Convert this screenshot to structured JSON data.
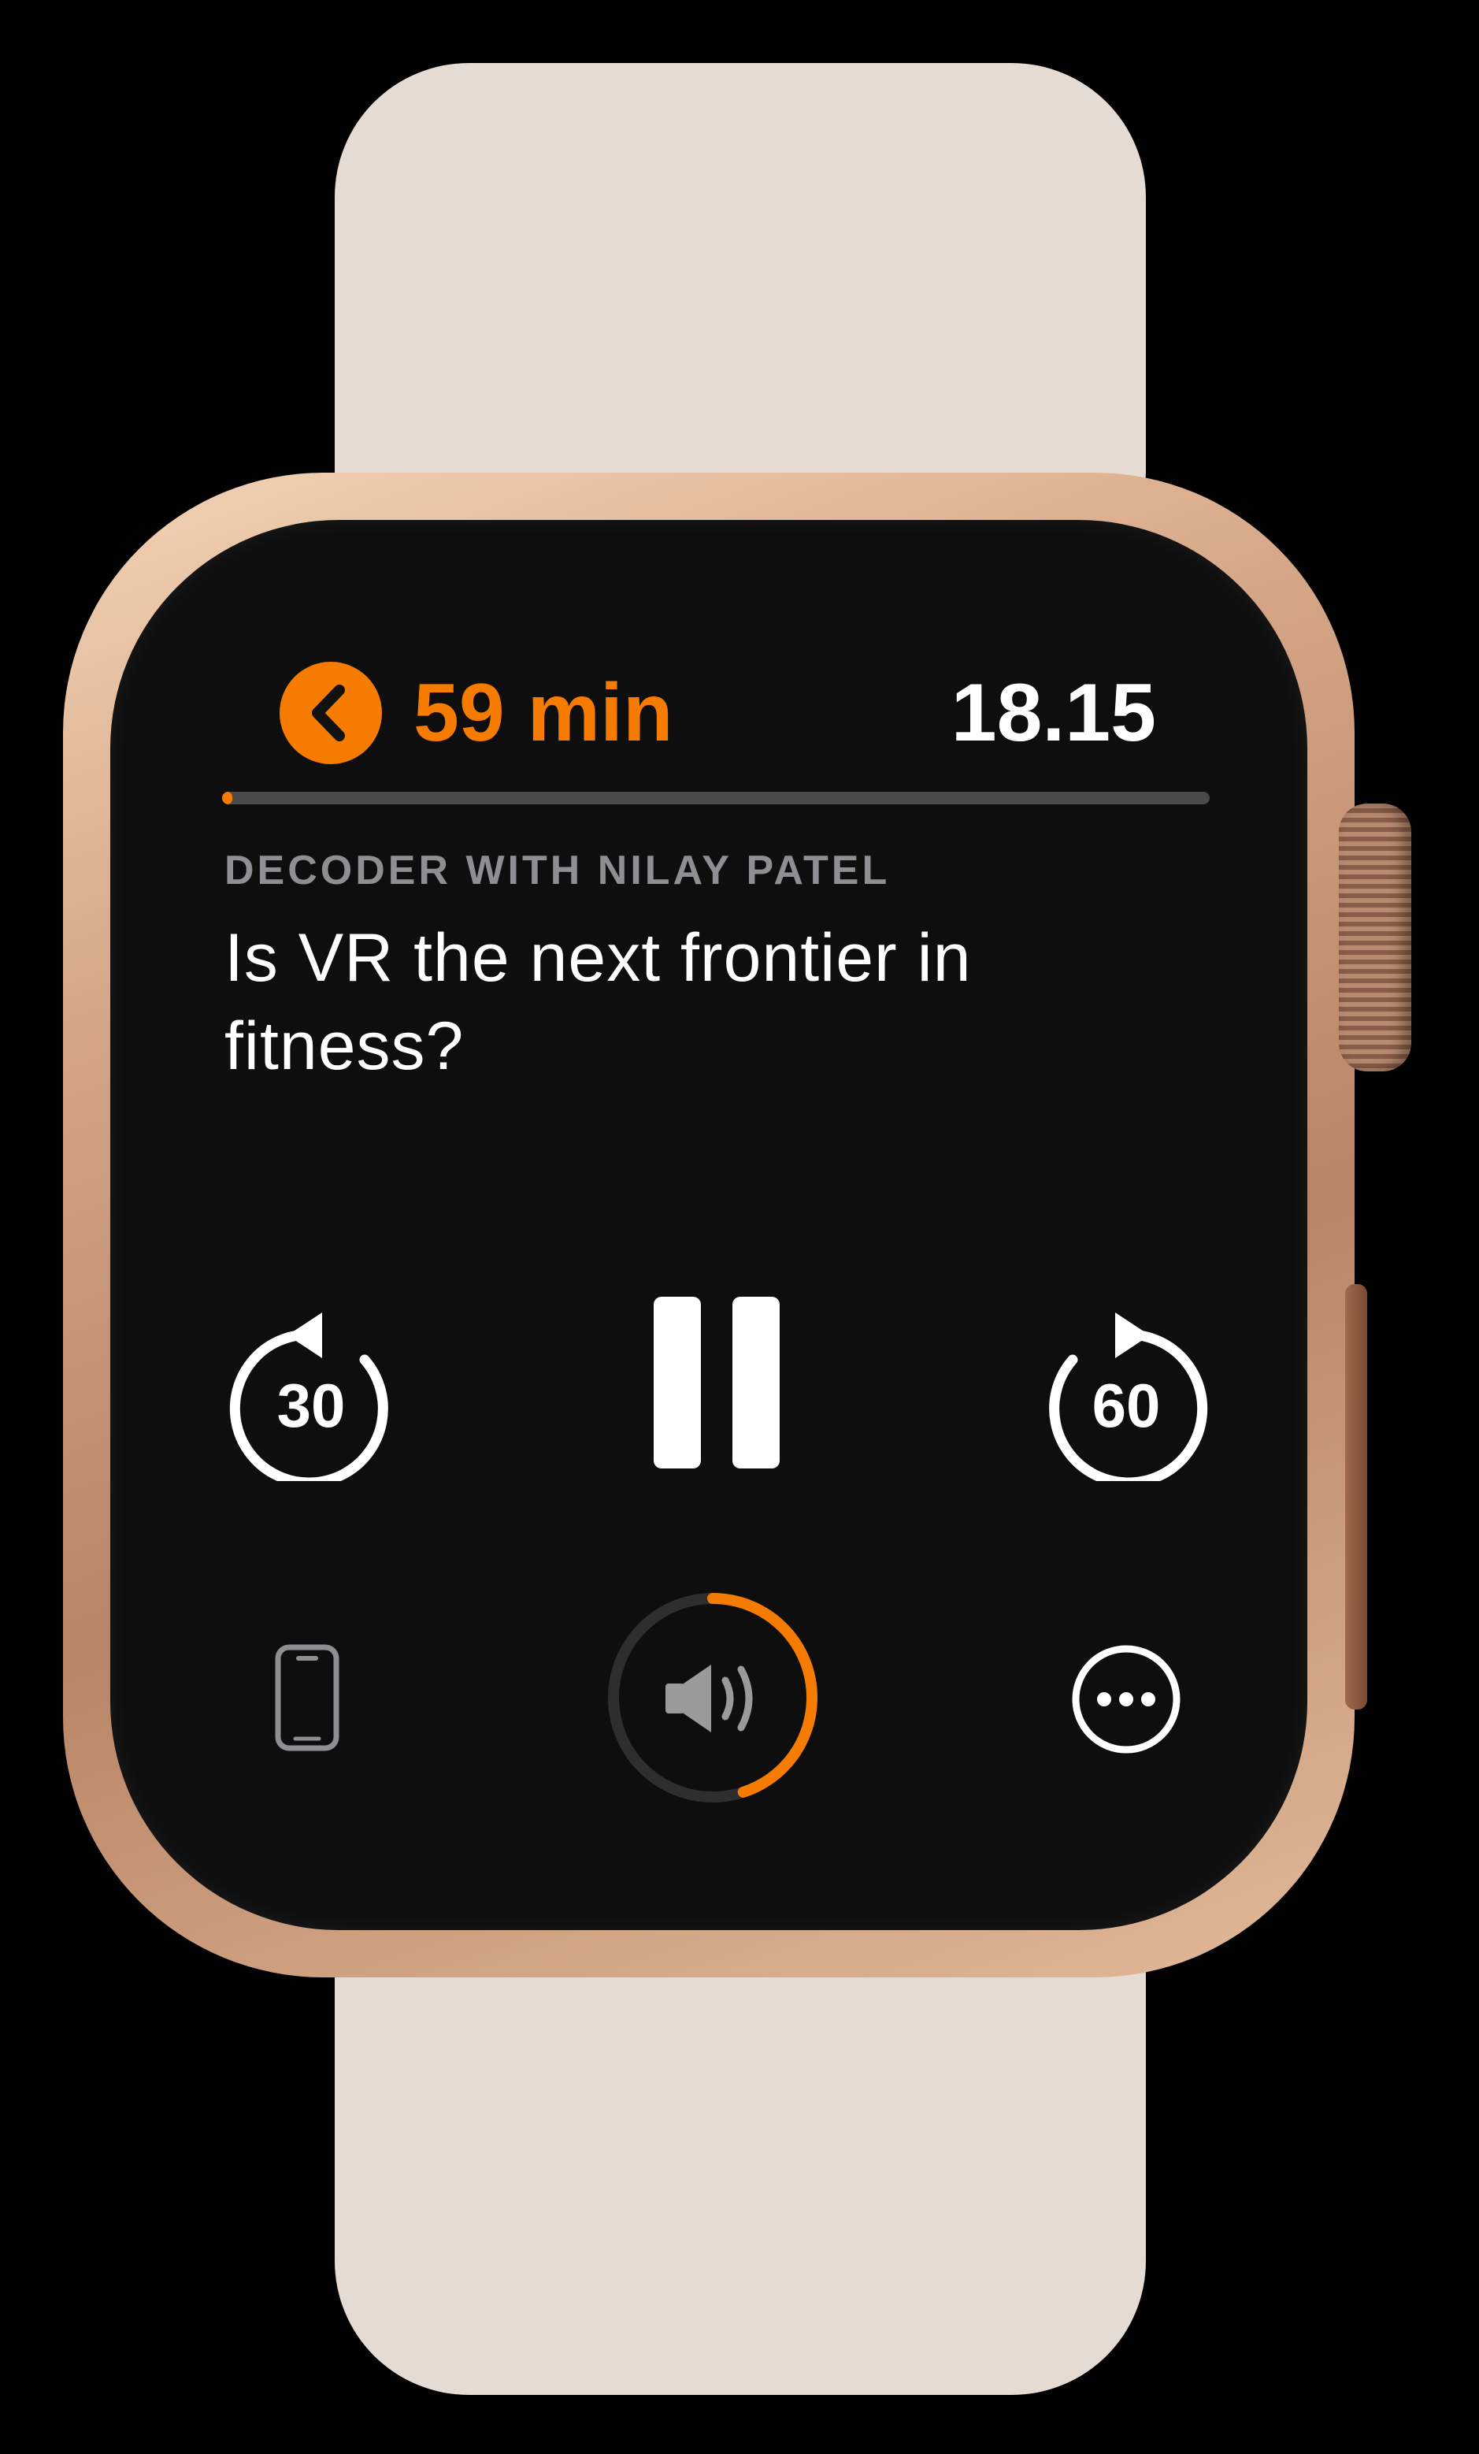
{
  "header": {
    "back_icon": "chevron-left-icon",
    "duration": "59 min",
    "time": "18.15"
  },
  "progress": {
    "fraction": 0.01
  },
  "episode": {
    "show": "DECODER WITH NILAY PATEL",
    "title": "Is VR the next frontier in fitness?"
  },
  "controls": {
    "skip_back": "30",
    "skip_forward": "60",
    "play_state_icon": "pause-icon"
  },
  "bottom_bar": {
    "device_icon": "iphone-icon",
    "volume_icon": "speaker-icon",
    "volume_level": 0.45,
    "more_icon": "ellipsis-circle-icon"
  },
  "colors": {
    "accent": "#f57c00",
    "text": "#ffffff",
    "secondary": "#8f8f93",
    "background": "#000000"
  }
}
